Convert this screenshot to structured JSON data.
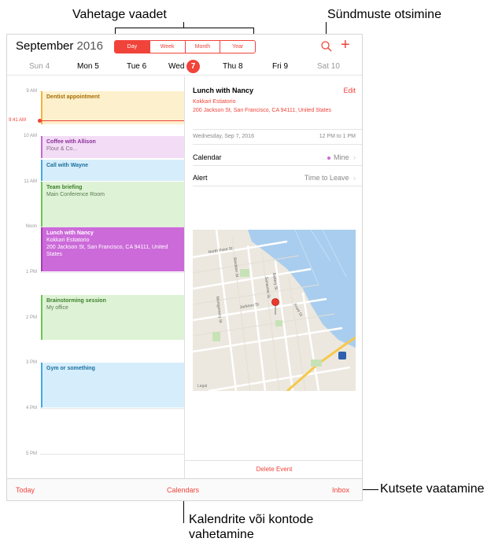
{
  "callouts": {
    "views": "Vahetage vaadet",
    "search": "Sündmuste otsimine",
    "invitations": "Kutsete vaatamine",
    "calendars_line1": "Kalendrite või kontode",
    "calendars_line2": "vahetamine"
  },
  "header": {
    "month": "September",
    "year": "2016",
    "views": [
      "Day",
      "Week",
      "Month",
      "Year"
    ],
    "active_view": "Day"
  },
  "week_days": {
    "sun": "Sun 4",
    "mon": "Mon 5",
    "tue": "Tue 6",
    "wed": "Wed",
    "wed_num": "7",
    "thu": "Thu 8",
    "fri": "Fri 9",
    "sat": "Sat 10"
  },
  "hours": [
    "9 AM",
    "10 AM",
    "11 AM",
    "Noon",
    "1 PM",
    "2 PM",
    "3 PM",
    "4 PM",
    "5 PM"
  ],
  "now_label": "9:41 AM",
  "events": [
    {
      "title": "Dentist appointment",
      "sub": ""
    },
    {
      "title": "Coffee with Allison",
      "sub": "Flour & Co..."
    },
    {
      "title": "Call with Wayne",
      "sub": ""
    },
    {
      "title": "Team briefing",
      "sub": "Main Conference Room"
    },
    {
      "title": "Lunch with Nancy",
      "sub": "Kokkari Estiatorio",
      "sub2": "200 Jackson St, San Francisco, CA 94111, United States"
    },
    {
      "title": "Brainstorming session",
      "sub": "My office"
    },
    {
      "title": "Gym or something",
      "sub": ""
    }
  ],
  "detail": {
    "title": "Lunch with Nancy",
    "edit": "Edit",
    "place": "Kokkari Estiatorio",
    "address": "200 Jackson St, San Francisco, CA 94111, United States",
    "date": "Wednesday, Sep 7, 2016",
    "time": "12 PM to 1 PM",
    "calendar_label": "Calendar",
    "calendar_value": "Mine",
    "alert_label": "Alert",
    "alert_value": "Time to Leave",
    "map_legal": "Legal"
  },
  "map_labels": {
    "north_point": "North Point St",
    "sansome": "Sansome St",
    "battery": "Battery St",
    "stockton": "Stockton St",
    "jackson": "Jackson St",
    "montgomery": "Montgomery St",
    "front": "Front St"
  },
  "delete_label": "Delete Event",
  "bottom": {
    "today": "Today",
    "calendars": "Calendars",
    "inbox": "Inbox"
  },
  "colors": {
    "accent": "#f0433a"
  }
}
